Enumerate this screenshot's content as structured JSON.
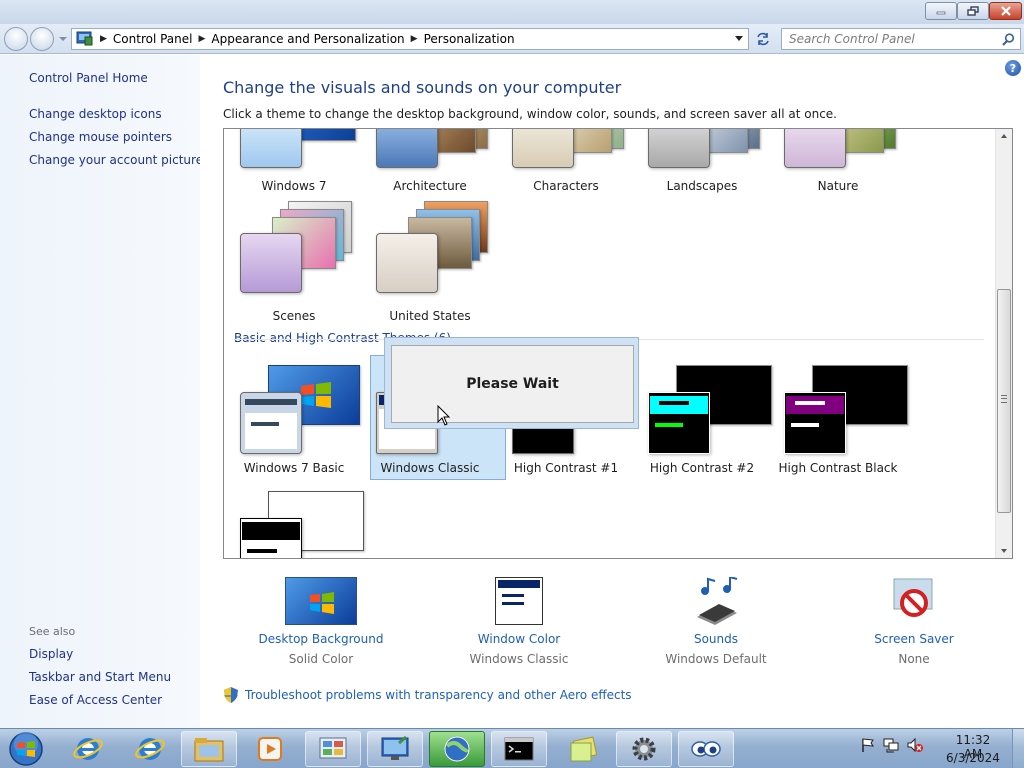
{
  "address": {
    "crumbs": [
      "Control Panel",
      "Appearance and Personalization",
      "Personalization"
    ],
    "search_placeholder": "Search Control Panel"
  },
  "left_pane": {
    "home": "Control Panel Home",
    "links": [
      "Change desktop icons",
      "Change mouse pointers",
      "Change your account picture"
    ],
    "see_also_label": "See also",
    "see_also": [
      "Display",
      "Taskbar and Start Menu",
      "Ease of Access Center"
    ]
  },
  "main": {
    "title": "Change the visuals and sounds on your computer",
    "subtitle": "Click a theme to change the desktop background, window color, sounds, and screen saver all at once.",
    "aero_themes": [
      "Windows 7",
      "Architecture",
      "Characters",
      "Landscapes",
      "Nature",
      "Scenes",
      "United States"
    ],
    "basic_section_label": "Basic and High Contrast Themes (6)",
    "basic_themes": [
      "Windows 7 Basic",
      "Windows Classic",
      "High Contrast #1",
      "High Contrast #2",
      "High Contrast Black"
    ],
    "selected_theme": "Windows Classic",
    "popup_text": "Please Wait",
    "options": [
      {
        "label": "Desktop Background",
        "value": "Solid Color"
      },
      {
        "label": "Window Color",
        "value": "Windows Classic"
      },
      {
        "label": "Sounds",
        "value": "Windows Default"
      },
      {
        "label": "Screen Saver",
        "value": "None"
      }
    ],
    "troubleshoot": "Troubleshoot problems with transparency and other Aero effects"
  },
  "taskbar": {
    "time": "11:32 AM",
    "date": "6/3/2024"
  },
  "colors": {
    "link": "#1f5fb6",
    "title_blue": "#1e3f8c",
    "selection": "#cce4f7",
    "hc2_cyan": "#00ffff",
    "hc2_green": "#00ff00",
    "hc_black_magenta": "#800080"
  }
}
